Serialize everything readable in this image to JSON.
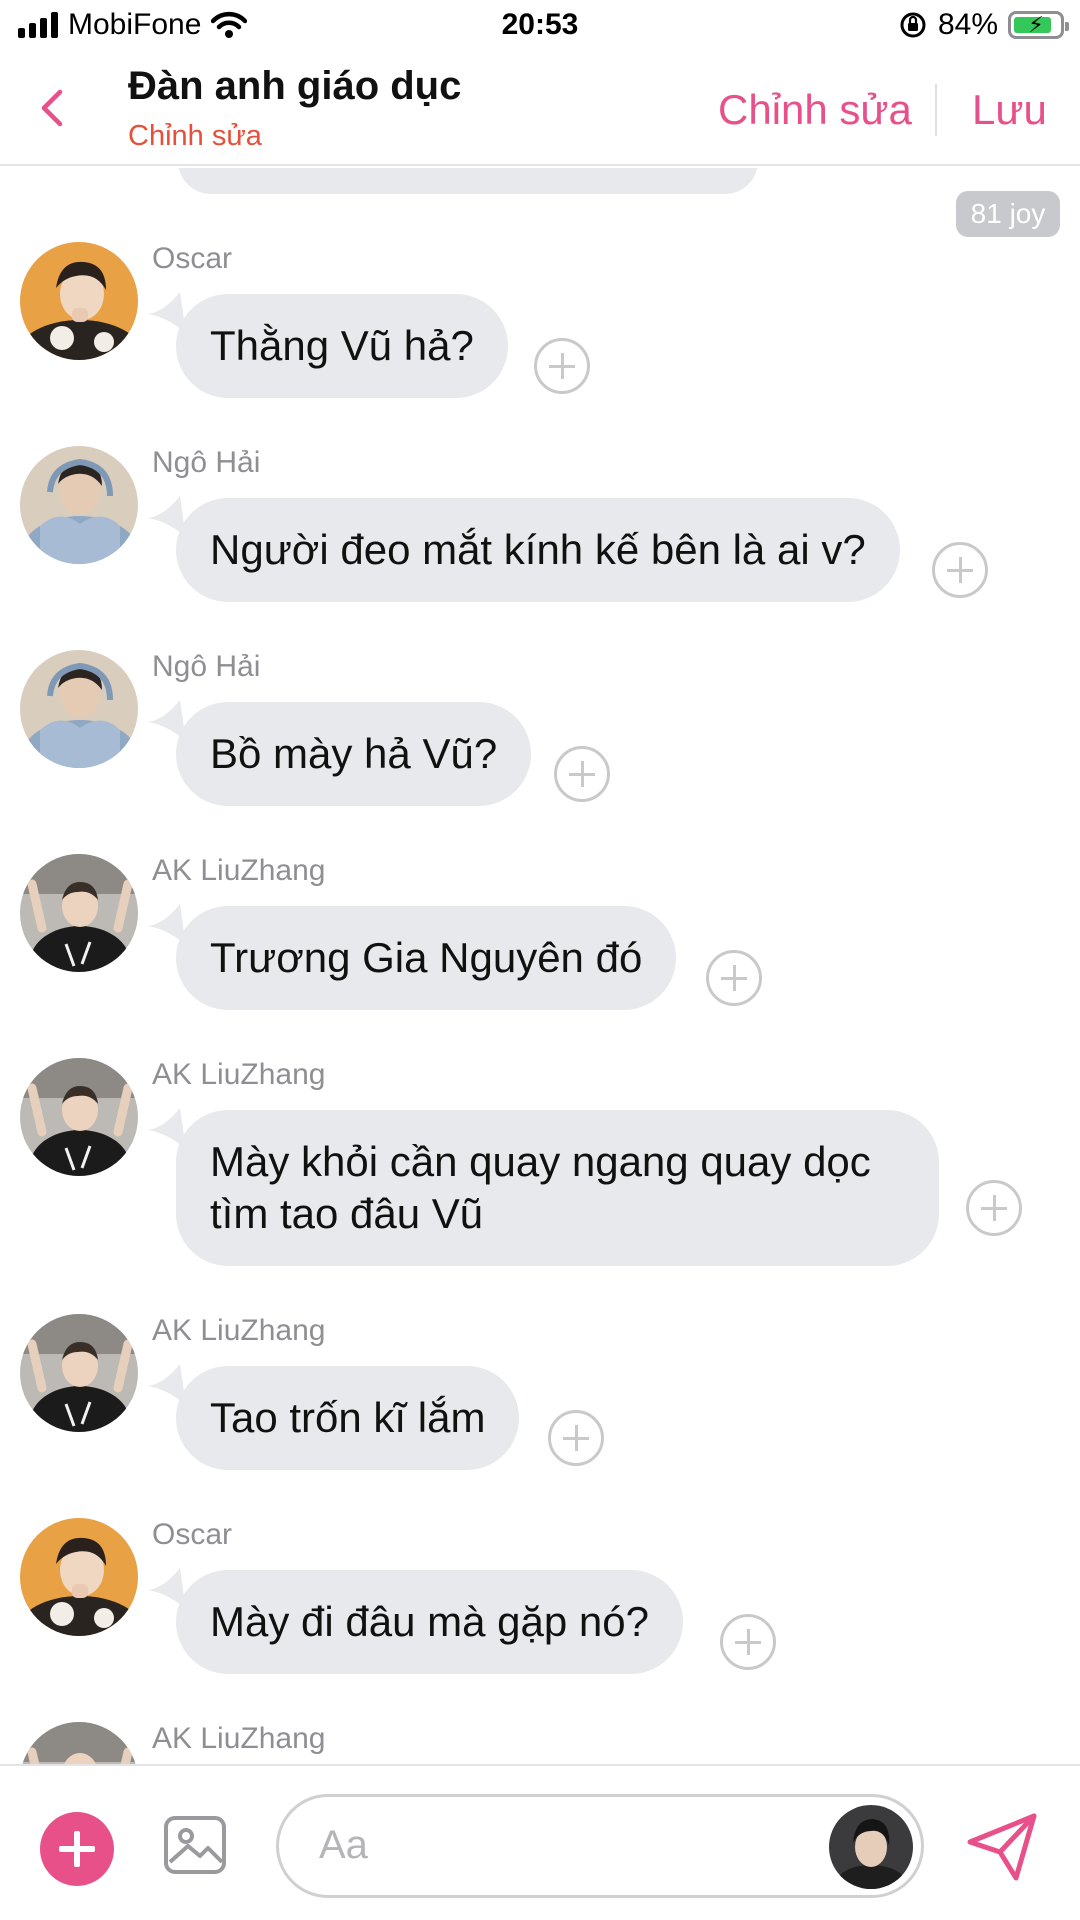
{
  "status_bar": {
    "carrier": "MobiFone",
    "time": "20:53",
    "battery_percent": "84%",
    "battery_level": 0.84
  },
  "header": {
    "title": "Đàn anh giáo dục",
    "subtitle": "Chỉnh sửa",
    "edit_label": "Chỉnh sửa",
    "save_label": "Lưu"
  },
  "chat": {
    "joy_badge": "81 joy",
    "messages": [
      {
        "sender": "Oscar",
        "text": "Thằng Vũ hả?"
      },
      {
        "sender": "Ngô Hải",
        "text": "Người đeo mắt kính kế bên là ai v?"
      },
      {
        "sender": "Ngô Hải",
        "text": "Bồ mày hả Vũ?"
      },
      {
        "sender": "AK LiuZhang",
        "text": "Trương Gia Nguyên đó"
      },
      {
        "sender": "AK LiuZhang",
        "text_line1": "Mày khỏi cần quay ngang quay dọc",
        "text_line2": "tìm tao đâu Vũ"
      },
      {
        "sender": "AK LiuZhang",
        "text": "Tao trốn kĩ lắm"
      },
      {
        "sender": "Oscar",
        "text": "Mày đi đâu mà gặp nó?"
      },
      {
        "sender": "AK LiuZhang"
      }
    ]
  },
  "composer": {
    "placeholder": "Aa"
  },
  "icons": {
    "back": "chevron-left-icon",
    "add": "plus-icon",
    "image": "image-icon",
    "send": "send-icon",
    "react": "add-reaction-icon"
  },
  "colors": {
    "accent": "#e8508a",
    "subtitle": "#e84f3a",
    "bubble": "#e8e9ec",
    "sender": "#8e8e93"
  }
}
